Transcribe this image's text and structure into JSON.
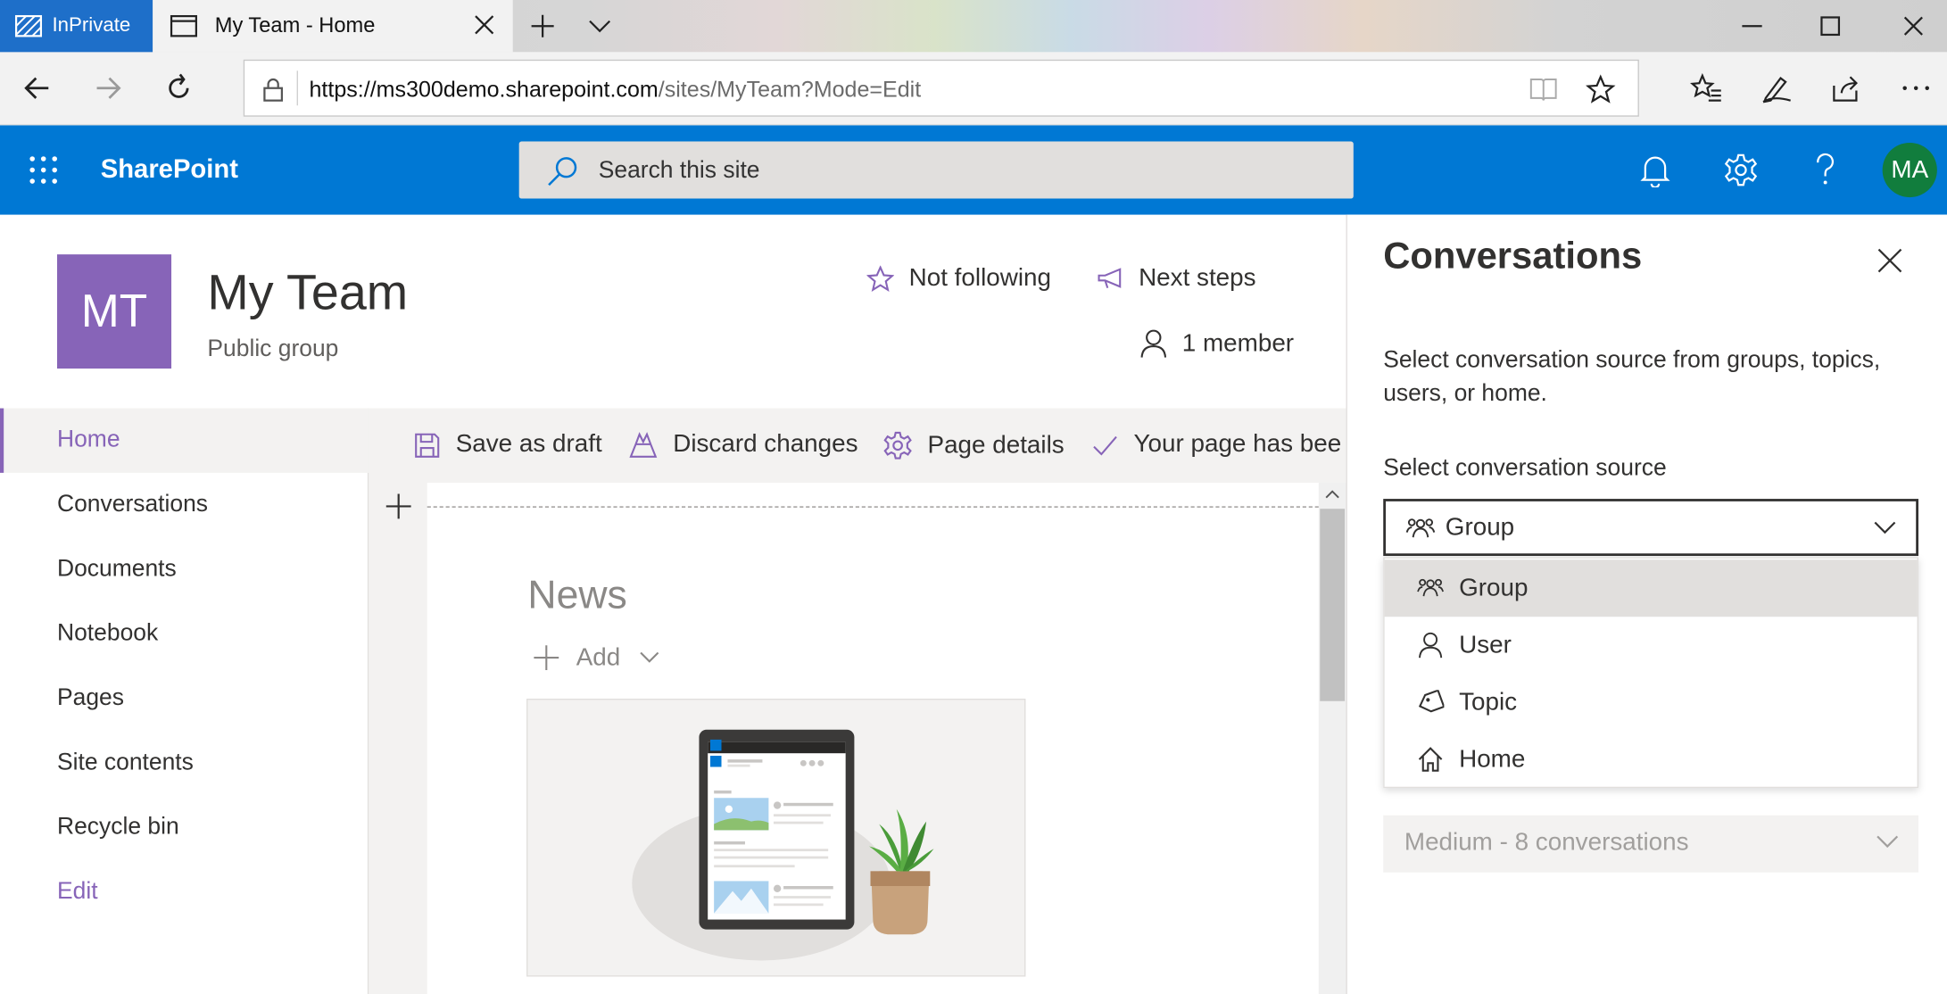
{
  "browser": {
    "inprivate_label": "InPrivate",
    "tab_title": "My Team - Home",
    "url_host": "https://ms300demo.sharepoint.com",
    "url_path": "/sites/MyTeam?Mode=Edit"
  },
  "suite": {
    "app_name": "SharePoint",
    "search_placeholder": "Search this site",
    "avatar_initials": "MA",
    "brand_color": "#0078d4"
  },
  "site": {
    "logo_initials": "MT",
    "title": "My Team",
    "subtitle": "Public group",
    "follow_label": "Not following",
    "next_steps_label": "Next steps",
    "members_label": "1 member"
  },
  "nav": {
    "items": [
      {
        "label": "Home",
        "active": true
      },
      {
        "label": "Conversations"
      },
      {
        "label": "Documents"
      },
      {
        "label": "Notebook"
      },
      {
        "label": "Pages"
      },
      {
        "label": "Site contents"
      },
      {
        "label": "Recycle bin"
      },
      {
        "label": "Edit"
      }
    ]
  },
  "commands": {
    "save_draft": "Save as draft",
    "discard": "Discard changes",
    "page_details": "Page details",
    "status": "Your page has bee"
  },
  "canvas": {
    "news_title": "News",
    "add_label": "Add"
  },
  "panel": {
    "title": "Conversations",
    "description": "Select conversation source from groups, topics, users, or home.",
    "source_label": "Select conversation source",
    "selected_value": "Group",
    "options": [
      {
        "label": "Group",
        "icon": "group-icon",
        "selected": true
      },
      {
        "label": "User",
        "icon": "user-icon"
      },
      {
        "label": "Topic",
        "icon": "tag-icon"
      },
      {
        "label": "Home",
        "icon": "home-icon"
      }
    ],
    "count_value": "Medium - 8 conversations"
  }
}
